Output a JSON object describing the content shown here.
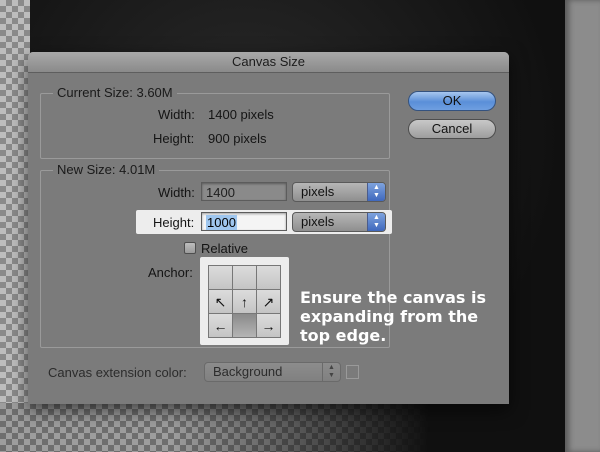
{
  "dialog": {
    "title": "Canvas Size",
    "ok_label": "OK",
    "cancel_label": "Cancel"
  },
  "current_size": {
    "title": "Current Size: 3.60M",
    "width_label": "Width:",
    "width_value": "1400 pixels",
    "height_label": "Height:",
    "height_value": "900 pixels"
  },
  "new_size": {
    "title": "New Size: 4.01M",
    "width_label": "Width:",
    "width_value": "1400",
    "width_unit": "pixels",
    "height_label": "Height:",
    "height_value": "1000",
    "height_unit": "pixels",
    "relative_label": "Relative",
    "relative_checked": false,
    "anchor_label": "Anchor:",
    "anchor_cells": [
      "",
      "",
      "",
      "↖",
      "↑",
      "↗",
      "←",
      "",
      "→"
    ],
    "anchor_selected": "bottom-center"
  },
  "extension": {
    "label": "Canvas extension color:",
    "value": "Background"
  },
  "annotation": {
    "text": "Ensure the canvas is expanding from the top edge."
  },
  "colors": {
    "dialog_bg": "#7b7b7b",
    "default_button": "#5a8fd8",
    "highlight": "#ededed"
  }
}
